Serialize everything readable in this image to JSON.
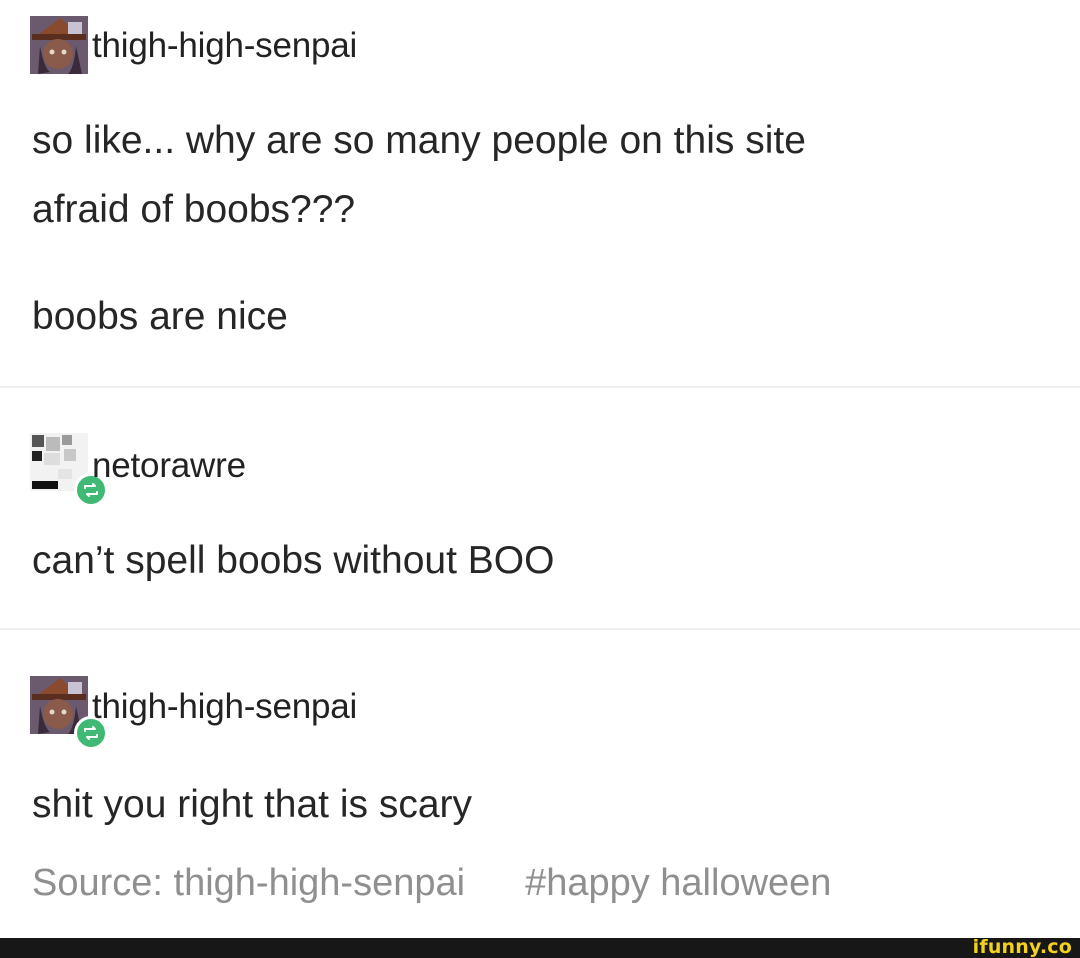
{
  "posts": [
    {
      "username": "thigh-high-senpai",
      "avatar_icon": "witch-avatar-icon",
      "lines": [
        "so like... why are so many people on this site",
        "afraid of boobs???",
        "",
        "boobs are nice"
      ]
    },
    {
      "username": "netorawre",
      "avatar_icon": "pixel-avatar-icon",
      "reblog_icon": "reblog-icon",
      "lines": [
        "can’t spell boobs without BOO"
      ]
    },
    {
      "username": "thigh-high-senpai",
      "avatar_icon": "witch-avatar-icon",
      "reblog_icon": "reblog-icon",
      "lines": [
        "shit you right that is scary"
      ]
    }
  ],
  "footer": {
    "source": "Source: thigh-high-senpai",
    "tag": "#happy halloween"
  },
  "watermark": "ifunny.co",
  "colors": {
    "reblog_green": "#3fb973",
    "watermark_yellow": "#f2d21d",
    "footer_bar": "#171717",
    "source_gray": "#8f8f8f"
  }
}
